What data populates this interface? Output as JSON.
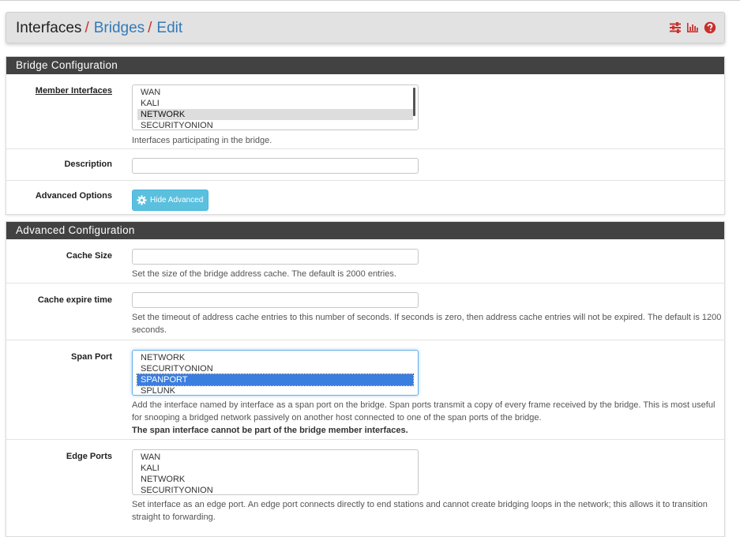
{
  "breadcrumb": {
    "items": [
      "Interfaces",
      "Bridges",
      "Edit"
    ],
    "separator": "/"
  },
  "header_icons": [
    "sliders-icon",
    "bar-chart-icon",
    "help-icon"
  ],
  "colors": {
    "accent_red": "#c9302c",
    "link_blue": "#337ab7",
    "panel_header": "#424242",
    "info_button": "#5bc0de",
    "selection_blue": "#3a7ee0"
  },
  "bridge_config": {
    "title": "Bridge Configuration",
    "member_interfaces": {
      "label": "Member Interfaces",
      "options": [
        "WAN",
        "KALI",
        "NETWORK",
        "SECURITYONION"
      ],
      "selected": "NETWORK",
      "help": "Interfaces participating in the bridge."
    },
    "description": {
      "label": "Description",
      "value": ""
    },
    "advanced_options": {
      "label": "Advanced Options",
      "button": "Hide Advanced"
    }
  },
  "advanced_config": {
    "title": "Advanced Configuration",
    "cache_size": {
      "label": "Cache Size",
      "value": "",
      "help": "Set the size of the bridge address cache. The default is 2000 entries."
    },
    "cache_expire": {
      "label": "Cache expire time",
      "value": "",
      "help": "Set the timeout of address cache entries to this number of seconds. If seconds is zero, then address cache entries will not be expired. The default is 1200 seconds."
    },
    "span_port": {
      "label": "Span Port",
      "options": [
        "NETWORK",
        "SECURITYONION",
        "SPANPORT",
        "SPLUNK"
      ],
      "selected": "SPANPORT",
      "help": "Add the interface named by interface as a span port on the bridge. Span ports transmit a copy of every frame received by the bridge. This is most useful for snooping a bridged network passively on another host connected to one of the span ports of the bridge.",
      "help_bold": "The span interface cannot be part of the bridge member interfaces."
    },
    "edge_ports": {
      "label": "Edge Ports",
      "options": [
        "WAN",
        "KALI",
        "NETWORK",
        "SECURITYONION"
      ],
      "help": "Set interface as an edge port. An edge port connects directly to end stations and cannot create bridging loops in the network; this allows it to transition straight to forwarding."
    }
  }
}
